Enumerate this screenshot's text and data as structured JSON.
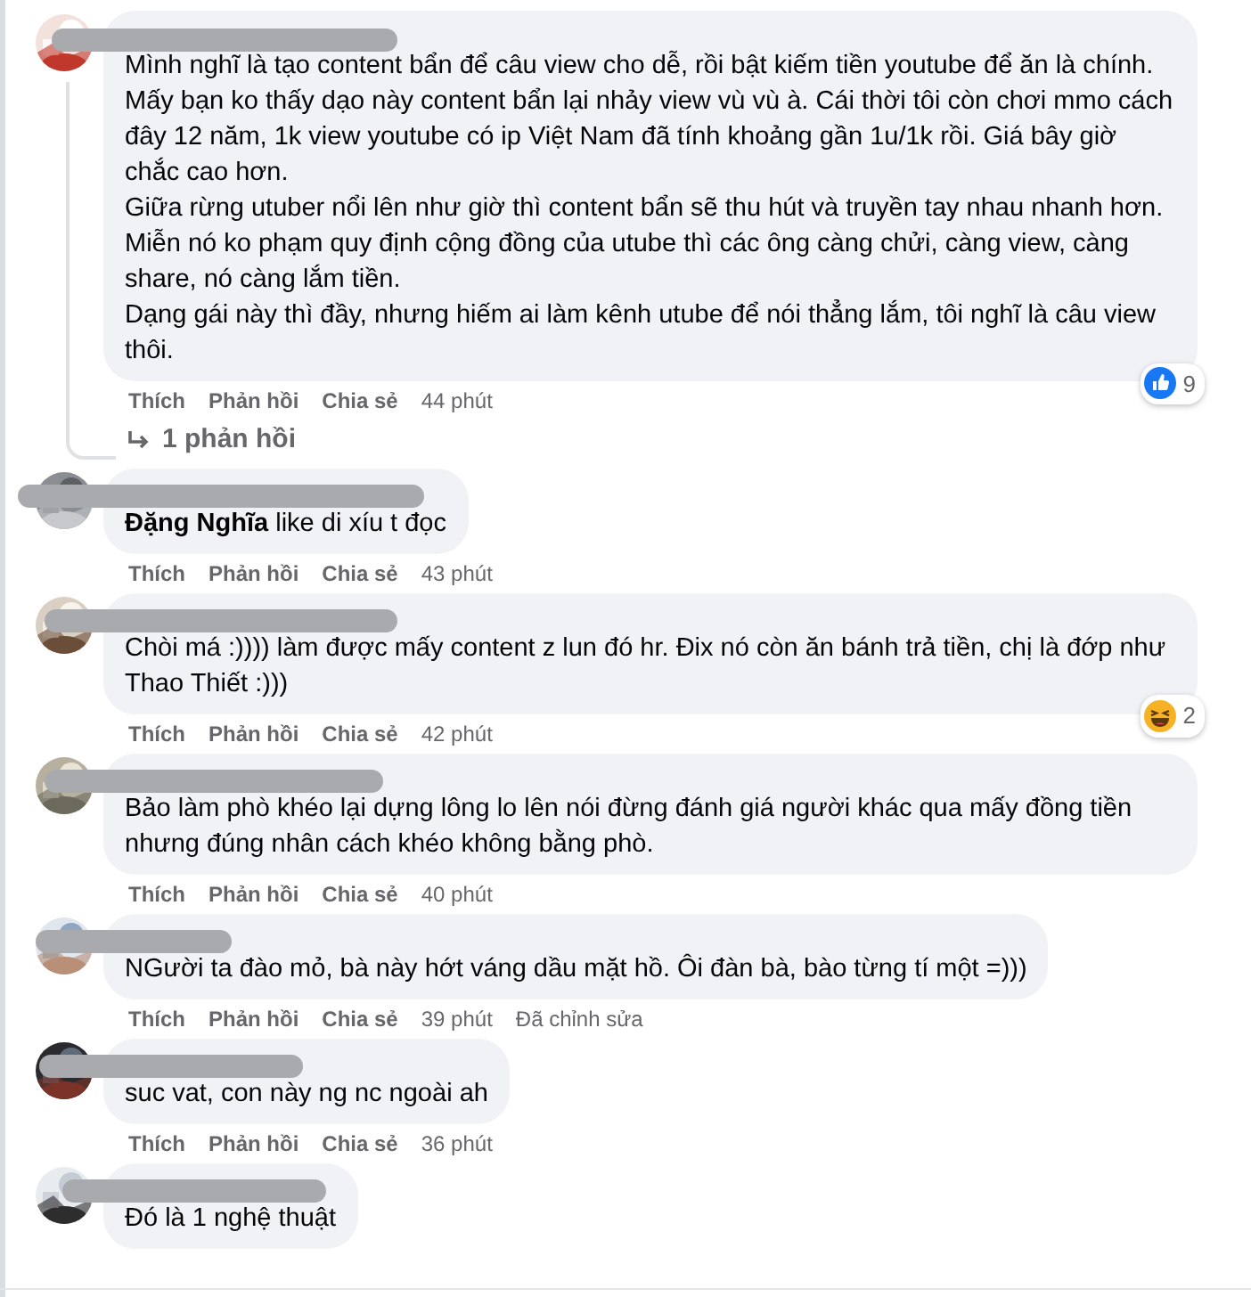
{
  "comments": [
    {
      "paragraphs": [
        "Mình nghĩ là tạo content bẩn để câu view cho dễ, rồi bật kiếm tiền youtube để ăn là chính. Mấy bạn ko thấy dạo này content bẩn lại nhảy view vù vù à. Cái thời tôi còn chơi mmo cách đây 12 năm, 1k view youtube có ip Việt Nam đã tính khoảng gần 1u/1k rồi. Giá bây giờ chắc cao hơn.",
        "Giữa rừng utuber nổi lên như giờ thì content bẩn sẽ thu hút và truyền tay nhau nhanh hơn. Miễn nó ko phạm quy định cộng đồng của utube thì các ông càng chửi, càng view, càng share, nó càng lắm tiền.",
        "Dạng gái này thì đầy, nhưng hiếm ai làm kênh utube để nói thẳng lắm, tôi nghĩ là câu view thôi."
      ],
      "reaction": {
        "kind": "like",
        "count": "9"
      },
      "actions": [
        "Thích",
        "Phản hồi",
        "Chia sẻ"
      ],
      "time": "44 phút",
      "replies": "1 phản hồi"
    },
    {
      "paragraphs": [
        "**Đặng Nghĩa** like di xíu t đọc"
      ],
      "actions": [
        "Thích",
        "Phản hồi",
        "Chia sẻ"
      ],
      "time": "43 phút"
    },
    {
      "paragraphs": [
        "Chòi má :)))) làm được mấy content z lun đó hr. Đix nó còn ăn bánh trả tiền, chị là đớp như Thao Thiết :)))"
      ],
      "reaction": {
        "kind": "haha",
        "count": "2"
      },
      "actions": [
        "Thích",
        "Phản hồi",
        "Chia sẻ"
      ],
      "time": "42 phút"
    },
    {
      "paragraphs": [
        "Bảo làm phò khéo lại dựng lông lo lên nói đừng đánh giá người khác qua mấy đồng tiền nhưng đúng nhân cách khéo không bằng phò."
      ],
      "actions": [
        "Thích",
        "Phản hồi",
        "Chia sẻ"
      ],
      "time": "40 phút"
    },
    {
      "paragraphs": [
        "NGười ta đào mỏ, bà này hớt váng dầu mặt hồ. Ôi đàn bà, bào từng tí một =)))"
      ],
      "actions": [
        "Thích",
        "Phản hồi",
        "Chia sẻ"
      ],
      "time": "39 phút",
      "edited": "Đã chỉnh sửa"
    },
    {
      "paragraphs": [
        "suc vat, con này ng nc ngoài ah"
      ],
      "actions": [
        "Thích",
        "Phản hồi",
        "Chia sẻ"
      ],
      "time": "36 phút"
    },
    {
      "paragraphs": [
        "Đó là 1 nghệ thuật"
      ]
    }
  ]
}
